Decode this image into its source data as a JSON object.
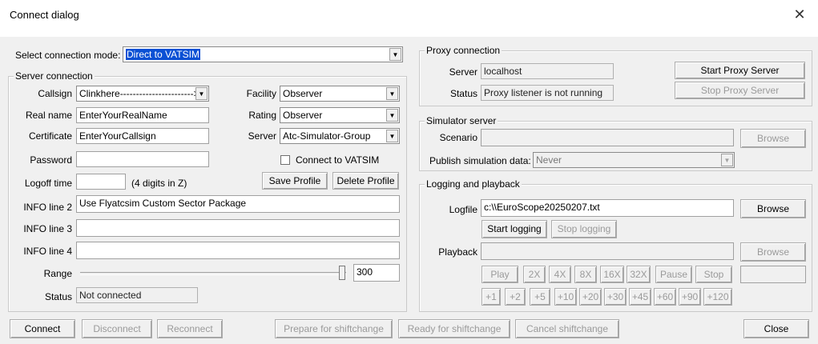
{
  "window": {
    "title": "Connect dialog",
    "close_glyph": "✕"
  },
  "mode": {
    "label": "Select connection mode:",
    "value": "Direct to VATSIM"
  },
  "server_connection": {
    "group_label": "Server connection",
    "callsign_label": "Callsign",
    "callsign_value": "Clinkhere----------------------->",
    "facility_label": "Facility",
    "facility_value": "Observer",
    "realname_label": "Real name",
    "realname_value": "EnterYourRealName",
    "rating_label": "Rating",
    "rating_value": "Observer",
    "certificate_label": "Certificate",
    "certificate_value": "EnterYourCallsign",
    "server_label": "Server",
    "server_value": "Atc-Simulator-Group",
    "password_label": "Password",
    "password_value": "",
    "connect_vatsim_label": "Connect to VATSIM",
    "logoff_label": "Logoff time",
    "logoff_value": "",
    "logoff_hint": "(4 digits in Z)",
    "save_profile": "Save Profile",
    "delete_profile": "Delete Profile",
    "info2_label": "INFO line 2",
    "info2_value": "Use Flyatcsim Custom Sector Package",
    "info3_label": "INFO line 3",
    "info3_value": "",
    "info4_label": "INFO line 4",
    "info4_value": "",
    "range_label": "Range",
    "range_value": "300",
    "status_label": "Status",
    "status_value": "Not connected"
  },
  "proxy": {
    "group_label": "Proxy connection",
    "server_label": "Server",
    "server_value": "localhost",
    "status_label": "Status",
    "status_value": "Proxy listener is not running",
    "start_button": "Start Proxy Server",
    "stop_button": "Stop Proxy Server"
  },
  "simulator": {
    "group_label": "Simulator server",
    "scenario_label": "Scenario",
    "scenario_value": "",
    "browse_button": "Browse",
    "publish_label": "Publish simulation data:",
    "publish_value": "Never"
  },
  "logging": {
    "group_label": "Logging and playback",
    "logfile_label": "Logfile",
    "logfile_value": "c:\\\\EuroScope20250207.txt",
    "browse_button": "Browse",
    "start_logging": "Start logging",
    "stop_logging": "Stop logging",
    "playback_label": "Playback",
    "playback_value": "",
    "playback_browse": "Browse",
    "play": "Play",
    "x2": "2X",
    "x4": "4X",
    "x8": "8X",
    "x16": "16X",
    "x32": "32X",
    "pause": "Pause",
    "stop": "Stop",
    "time_value": "",
    "p1": "+1",
    "p2": "+2",
    "p5": "+5",
    "p10": "+10",
    "p20": "+20",
    "p30": "+30",
    "p45": "+45",
    "p60": "+60",
    "p90": "+90",
    "p120": "+120"
  },
  "bottom": {
    "connect": "Connect",
    "disconnect": "Disconnect",
    "reconnect": "Reconnect",
    "prepare": "Prepare for shiftchange",
    "ready": "Ready for shiftchange",
    "cancel": "Cancel shiftchange",
    "close": "Close"
  }
}
